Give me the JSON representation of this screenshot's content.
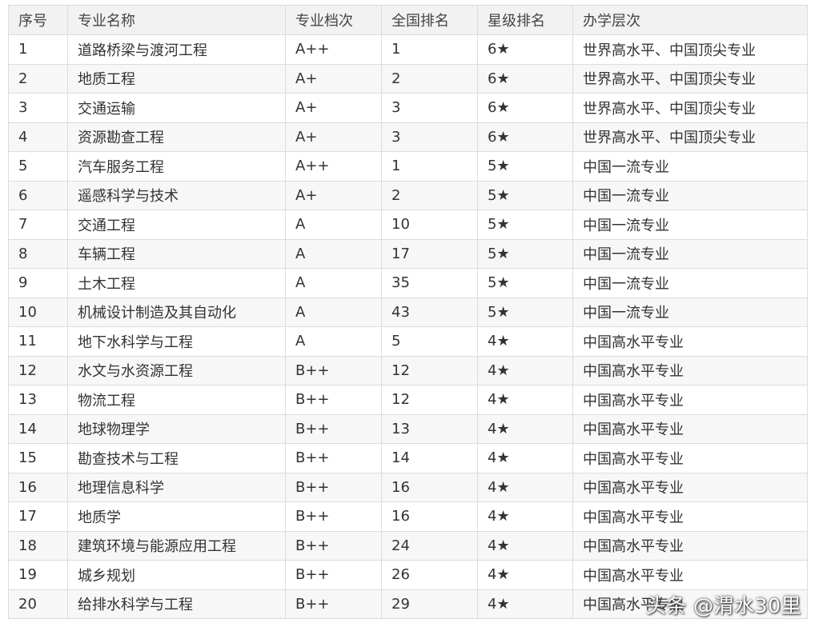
{
  "table": {
    "headers": [
      "序号",
      "专业名称",
      "专业档次",
      "全国排名",
      "星级排名",
      "办学层次"
    ],
    "rows": [
      [
        "1",
        "道路桥梁与渡河工程",
        "A++",
        "1",
        "6★",
        "世界高水平、中国顶尖专业"
      ],
      [
        "2",
        "地质工程",
        "A+",
        "2",
        "6★",
        "世界高水平、中国顶尖专业"
      ],
      [
        "3",
        "交通运输",
        "A+",
        "3",
        "6★",
        "世界高水平、中国顶尖专业"
      ],
      [
        "4",
        "资源勘查工程",
        "A+",
        "3",
        "6★",
        "世界高水平、中国顶尖专业"
      ],
      [
        "5",
        "汽车服务工程",
        "A++",
        "1",
        "5★",
        "中国一流专业"
      ],
      [
        "6",
        "遥感科学与技术",
        "A+",
        "2",
        "5★",
        "中国一流专业"
      ],
      [
        "7",
        "交通工程",
        "A",
        "10",
        "5★",
        "中国一流专业"
      ],
      [
        "8",
        "车辆工程",
        "A",
        "17",
        "5★",
        "中国一流专业"
      ],
      [
        "9",
        "土木工程",
        "A",
        "35",
        "5★",
        "中国一流专业"
      ],
      [
        "10",
        "机械设计制造及其自动化",
        "A",
        "43",
        "5★",
        "中国一流专业"
      ],
      [
        "11",
        "地下水科学与工程",
        "A",
        "5",
        "4★",
        "中国高水平专业"
      ],
      [
        "12",
        "水文与水资源工程",
        "B++",
        "12",
        "4★",
        "中国高水平专业"
      ],
      [
        "13",
        "物流工程",
        "B++",
        "12",
        "4★",
        "中国高水平专业"
      ],
      [
        "14",
        "地球物理学",
        "B++",
        "13",
        "4★",
        "中国高水平专业"
      ],
      [
        "15",
        "勘查技术与工程",
        "B++",
        "14",
        "4★",
        "中国高水平专业"
      ],
      [
        "16",
        "地理信息科学",
        "B++",
        "16",
        "4★",
        "中国高水平专业"
      ],
      [
        "17",
        "地质学",
        "B++",
        "16",
        "4★",
        "中国高水平专业"
      ],
      [
        "18",
        "建筑环境与能源应用工程",
        "B++",
        "24",
        "4★",
        "中国高水平专业"
      ],
      [
        "19",
        "城乡规划",
        "B++",
        "26",
        "4★",
        "中国高水平专业"
      ],
      [
        "20",
        "给排水科学与工程",
        "B++",
        "29",
        "4★",
        "中国高水平专业"
      ]
    ]
  },
  "watermark": "头条 @渭水30里"
}
